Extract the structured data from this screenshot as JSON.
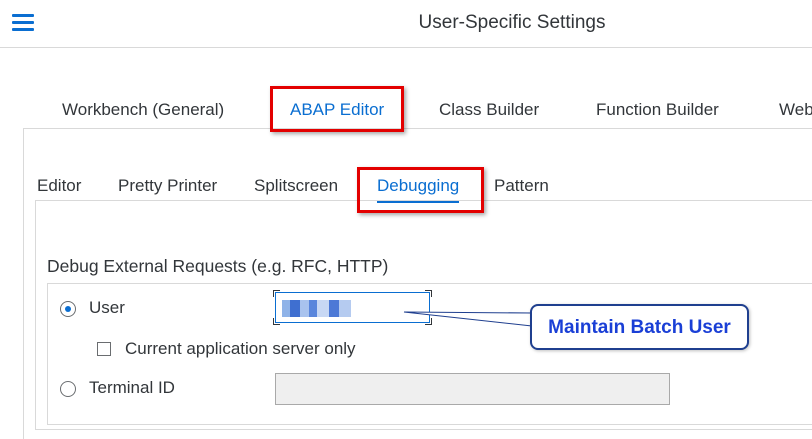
{
  "header": {
    "title": "User-Specific Settings",
    "menu_icon": "hamburger-menu-icon",
    "accent_color": "#0a6ed1"
  },
  "main_tabs": [
    {
      "label": "Workbench (General)",
      "active": false
    },
    {
      "label": "ABAP Editor",
      "active": true
    },
    {
      "label": "Class Builder",
      "active": false
    },
    {
      "label": "Function Builder",
      "active": false
    },
    {
      "label": "Web",
      "active": false
    }
  ],
  "sub_tabs": [
    {
      "label": "Editor",
      "active": false
    },
    {
      "label": "Pretty Printer",
      "active": false
    },
    {
      "label": "Splitscreen",
      "active": false
    },
    {
      "label": "Debugging",
      "active": true
    },
    {
      "label": "Pattern",
      "active": false
    }
  ],
  "debug_section": {
    "title": "Debug External Requests (e.g. RFC, HTTP)",
    "user_option": {
      "label": "User",
      "selected": true
    },
    "user_value_obscured": true,
    "current_server_only": {
      "label": "Current application server only",
      "checked": false
    },
    "terminal_option": {
      "label": "Terminal ID",
      "selected": false
    },
    "terminal_value": ""
  },
  "annotation": {
    "callout_text": "Maintain Batch User",
    "highlight_color": "#e30000",
    "callout_text_color": "#1a3fd6"
  }
}
